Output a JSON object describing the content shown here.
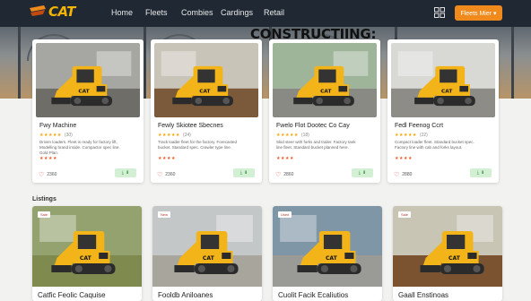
{
  "nav": {
    "logo": "CAT",
    "links": [
      "Home",
      "Fleets",
      "Combies",
      "Cardings",
      "Retail"
    ],
    "cta": "Fleets Mier ▾"
  },
  "hero": {
    "title": "CONSTRUCTIING:"
  },
  "cards": [
    {
      "title": "Fwy Machine",
      "reviews": "(30)",
      "desc": "Driven loaders. Fleet is ready for factory lift, Modelling brand inside. Compactor spec line. Gold Plan.",
      "count": "2360",
      "colors": {
        "bg": "#a6a7a2",
        "ground": "#6f6d68"
      }
    },
    {
      "title": "Fewly Skiotee Sbecnes",
      "reviews": "(24)",
      "desc": "Track loader fleet for the factory. Forecasted bucket. Standard spec. Crawler type line.",
      "count": "2360",
      "colors": {
        "bg": "#c9c4b8",
        "ground": "#7a5a3a"
      }
    },
    {
      "title": "Fwelo Flot Dootec Co Cay",
      "reviews": "(18)",
      "desc": "Skid steer with forks and trailer. Factory tank line fleet. Standard bucket planned here.",
      "count": "2860",
      "colors": {
        "bg": "#9fb59a",
        "ground": "#8a8a84"
      }
    },
    {
      "title": "Fedl Feenog Ccrt",
      "reviews": "(22)",
      "desc": "Compact loader fleet. Standard bucket spec. Factory line with cab and forks layout.",
      "count": "2880",
      "colors": {
        "bg": "#d8d8d4",
        "ground": "#8d8c86"
      }
    }
  ],
  "section": {
    "label": "Listings"
  },
  "cards2": [
    {
      "title": "Catfic Feolic Caquise",
      "tag": "Sale",
      "colors": {
        "bg": "#93a26e",
        "ground": "#7e8a4e"
      }
    },
    {
      "title": "Fooldb Aniloanes",
      "tag": "New",
      "colors": {
        "bg": "#c3c7c8",
        "ground": "#a7a59c"
      }
    },
    {
      "title": "Cuolit Facik Ecaliutios",
      "tag": "Used",
      "colors": {
        "bg": "#7f96a6",
        "ground": "#9a9a96"
      }
    },
    {
      "title": "Gaall Enstinoas",
      "tag": "Sale",
      "colors": {
        "bg": "#c8c5b5",
        "ground": "#7b5331"
      }
    }
  ],
  "theme": {
    "accent": "#f08a1c",
    "cat_yellow": "#f5b400",
    "nav_bg": "#1f2833"
  }
}
